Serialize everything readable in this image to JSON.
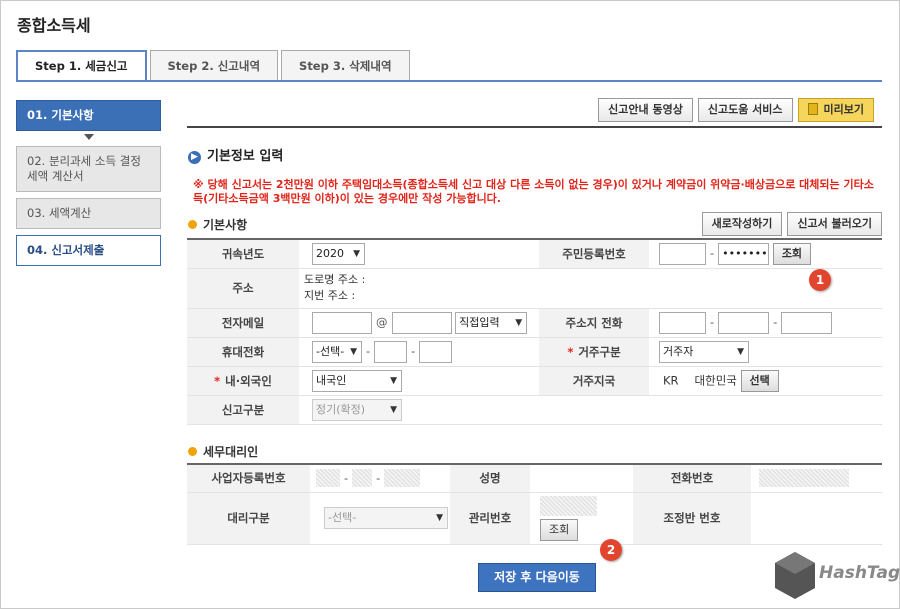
{
  "page_title": "종합소득세",
  "tabs": [
    {
      "label": "Step 1. 세금신고"
    },
    {
      "label": "Step 2. 신고내역"
    },
    {
      "label": "Step 3. 삭제내역"
    }
  ],
  "sidebar": {
    "items": [
      {
        "label": "01. 기본사항"
      },
      {
        "label": "02. 분리과세 소득 결정세액 계산서"
      },
      {
        "label": "03. 세액계산"
      },
      {
        "label": "04. 신고서제출"
      }
    ]
  },
  "top_buttons": {
    "video": "신고안내 동영상",
    "help": "신고도움 서비스",
    "preview": "미리보기"
  },
  "section": {
    "title": "기본정보 입력",
    "notice": "※ 당해 신고서는 2천만원 이하 주택임대소득(종합소득세 신고 대상 다른 소득이 없는 경우)이 있거나 계약금이 위약금·배상금으로 대체되는 기타소득(기타소득금액 3백만원 이하)이 있는 경우에만 작성 가능합니다."
  },
  "basic": {
    "title": "기본사항",
    "new_button": "새로작성하기",
    "load_button": "신고서 불러오기",
    "year_label": "귀속년도",
    "year_value": "2020",
    "rrn_label": "주민등록번호",
    "rrn_masked": "•••••••",
    "lookup_button": "조회",
    "address_label": "주소",
    "road_address": "도로명 주소 :",
    "lot_address": "지번 주소 :",
    "email_label": "전자메일",
    "email_at": "@",
    "email_domain": "직접입력",
    "home_phone_label": "주소지 전화",
    "mobile_label": "휴대전화",
    "mobile_select": "-선택-",
    "residence_label": "거주구분",
    "residence_value": "거주자",
    "nationality_label": "내·외국인",
    "nationality_value": "내국인",
    "country_label": "거주지국",
    "country_code": "KR",
    "country_name": "대한민국",
    "country_button": "선택",
    "report_type_label": "신고구분",
    "report_type_value": "정기(확정)"
  },
  "agent": {
    "title": "세무대리인",
    "biz_no_label": "사업자등록번호",
    "name_label": "성명",
    "phone_label": "전화번호",
    "agent_type_label": "대리구분",
    "agent_type_value": "-선택-",
    "manage_no_label": "관리번호",
    "manage_lookup": "조회",
    "adjust_no_label": "조정반 번호"
  },
  "save_button": "저장 후 다음이동",
  "badges": [
    "1",
    "2"
  ],
  "watermark": "HashTag",
  "colors": {
    "accent": "#3b6fb6",
    "notice": "#e1251b",
    "badge": "#e2452d",
    "preview": "#f6d55c"
  }
}
